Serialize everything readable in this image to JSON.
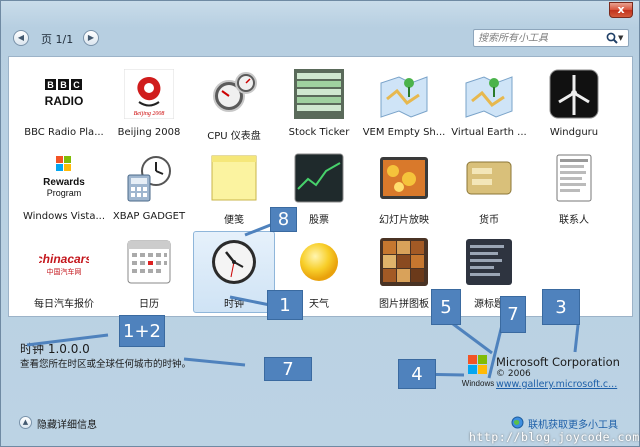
{
  "window": {
    "close_label": "x"
  },
  "toolbar": {
    "page_label": "页 1/1",
    "search_placeholder": "搜索所有小工具",
    "prev_icon": "chevron-left-icon",
    "next_icon": "chevron-right-icon"
  },
  "gadgets": [
    {
      "label": "BBC Radio Pla...",
      "icon": "bbc-radio-icon"
    },
    {
      "label": "Beijing 2008",
      "icon": "beijing-2008-icon"
    },
    {
      "label": "CPU 仪表盘",
      "icon": "cpu-meter-icon"
    },
    {
      "label": "Stock Ticker",
      "icon": "stock-ticker-icon"
    },
    {
      "label": "VEM Empty Sh...",
      "icon": "vem-map-icon"
    },
    {
      "label": "Virtual Earth ...",
      "icon": "virtual-earth-icon"
    },
    {
      "label": "Windguru",
      "icon": "windguru-icon"
    },
    {
      "label": "Windows Vista...",
      "icon": "windows-rewards-icon",
      "sub1": "Rewards",
      "sub2": "Program"
    },
    {
      "label": "XBAP GADGET",
      "icon": "xbap-gadget-icon"
    },
    {
      "label": "便笺",
      "icon": "notes-icon"
    },
    {
      "label": "股票",
      "icon": "stocks-icon"
    },
    {
      "label": "幻灯片放映",
      "icon": "slideshow-icon"
    },
    {
      "label": "货币",
      "icon": "currency-icon"
    },
    {
      "label": "联系人",
      "icon": "contacts-icon"
    },
    {
      "label": "每日汽车报价",
      "icon": "chinacars-icon"
    },
    {
      "label": "日历",
      "icon": "calendar-icon"
    },
    {
      "label": "时钟",
      "icon": "clock-icon"
    },
    {
      "label": "天气",
      "icon": "weather-icon"
    },
    {
      "label": "图片拼图板",
      "icon": "picture-puzzle-icon"
    },
    {
      "label": "源标题",
      "icon": "feed-headlines-icon"
    }
  ],
  "logo_text": {
    "bbc": "BBC",
    "radio": "RADIO",
    "beijing": "Beijing 2008",
    "chinacars": "chinacars",
    "chinacars_sub": "中国汽车网"
  },
  "details": {
    "title": "时钟 1.0.0.0",
    "description": "查看您所在时区或全球任何城市的时钟。",
    "company": "Microsoft Corporation",
    "copyright": "© 2006",
    "link": "www.gallery.microsoft.c...",
    "logo_label": "Windows"
  },
  "bottom": {
    "hide_details": "隐藏详细信息",
    "get_more": "联机获取更多小工具"
  },
  "watermark": "http://blog.joycode.com",
  "callouts": [
    "1",
    "1+2",
    "3",
    "4",
    "5",
    "7",
    "7",
    "8"
  ],
  "colors": {
    "callout": "#4f82bd",
    "link": "#1d5fa8",
    "window_bg": "#bcd3e4"
  }
}
